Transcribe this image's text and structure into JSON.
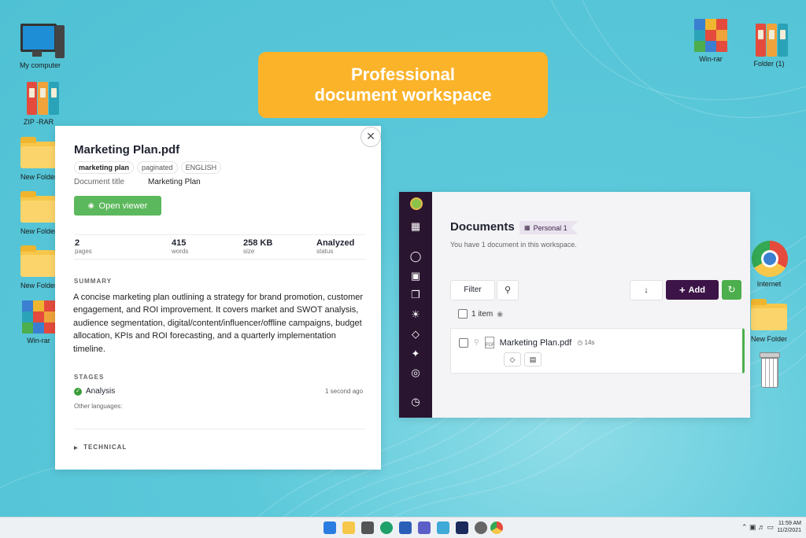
{
  "banner": {
    "line1": "Professional",
    "line2": "document workspace"
  },
  "desktop": {
    "icons": [
      "My computer",
      "ZIP -RAR",
      "New Folder",
      "New Folder",
      "New Folder",
      "Win-rar",
      "Win-rar",
      "Folder (1)",
      "Internet",
      "New Folder"
    ]
  },
  "panel": {
    "title": "Marketing Plan.pdf",
    "tags": [
      "marketing plan",
      "paginated",
      "ENGLISH"
    ],
    "doc_title_label": "Document title",
    "doc_title_value": "Marketing Plan",
    "open_viewer": "Open viewer",
    "stats": [
      {
        "value": "2",
        "label": "pages"
      },
      {
        "value": "415",
        "label": "words"
      },
      {
        "value": "258 KB",
        "label": "size"
      },
      {
        "value": "Analyzed",
        "label": "status"
      }
    ],
    "summary_heading": "SUMMARY",
    "summary": "A concise marketing plan outlining a strategy for brand promotion, customer engagement, and ROI improvement. It covers market and SWOT analysis, audience segmentation, digital/content/influencer/offline campaigns, budget allocation, KPIs and ROI forecasting, and a quarterly implementation timeline.",
    "stages_heading": "STAGES",
    "stage_name": "Analysis",
    "stage_time": "1 second ago",
    "other_languages": "Other languages:",
    "technical": "TECHNICAL"
  },
  "app": {
    "title": "Documents",
    "workspace": "Personal 1",
    "subtitle": "You have 1 document in this workspace.",
    "filter": "Filter",
    "add": "Add",
    "count": "1 item",
    "doc_name": "Marketing Plan.pdf",
    "doc_age": "14s"
  },
  "taskbar": {
    "time": "11:59 AM",
    "date": "11/2/2021"
  },
  "colors": {
    "banner": "#fbb32a",
    "add_button": "#3d1447",
    "sidebar": "#2a1530",
    "success": "#5cb85c"
  }
}
